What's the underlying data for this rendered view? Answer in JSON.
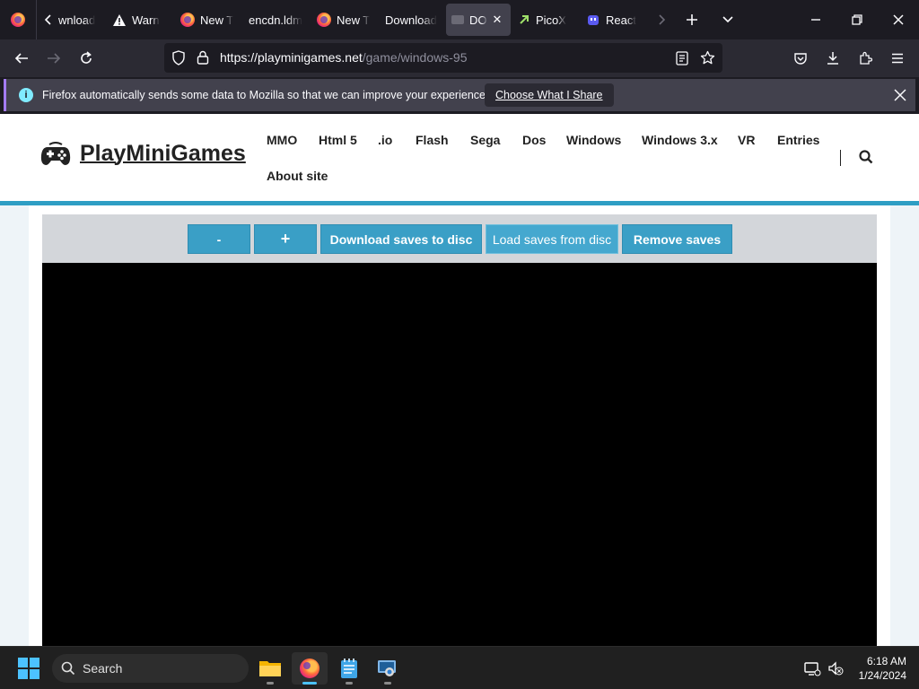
{
  "browser": {
    "tabs": [
      {
        "label": "wnload",
        "icon": "chevron-left-icon",
        "active": false
      },
      {
        "label": "Warn",
        "icon": "warning-icon",
        "active": false
      },
      {
        "label": "New T",
        "icon": "firefox-icon",
        "active": false
      },
      {
        "label": "encdn.ldm",
        "icon": "none",
        "active": false
      },
      {
        "label": "New T",
        "icon": "firefox-icon",
        "active": false
      },
      {
        "label": "Download",
        "icon": "none",
        "active": false
      },
      {
        "label": "DO",
        "icon": "page-icon",
        "active": true
      },
      {
        "label": "PicoX",
        "icon": "pico-icon",
        "active": false
      },
      {
        "label": "React",
        "icon": "ghost-icon",
        "active": false
      }
    ],
    "url": {
      "host": "https://playminigames.net",
      "path": "/game/windows-95"
    },
    "notification": {
      "text": "Firefox automatically sends some data to Mozilla so that we can improve your experience.",
      "button": "Choose What I Share"
    }
  },
  "site": {
    "logo": "PlayMiniGames",
    "menu": [
      "MMO",
      "Html 5",
      ".io",
      "Flash",
      "Sega",
      "Dos",
      "Windows",
      "Windows 3.x",
      "VR",
      "Entries",
      "About site"
    ],
    "controls": {
      "minus": "-",
      "plus": "+",
      "download": "Download saves to disc",
      "load": "Load saves from disc",
      "remove": "Remove saves"
    },
    "colors": {
      "accent": "#2e9ec4",
      "button": "#3a9fc6"
    }
  },
  "taskbar": {
    "search_placeholder": "Search",
    "time": "6:18 AM",
    "date": "1/24/2024"
  }
}
